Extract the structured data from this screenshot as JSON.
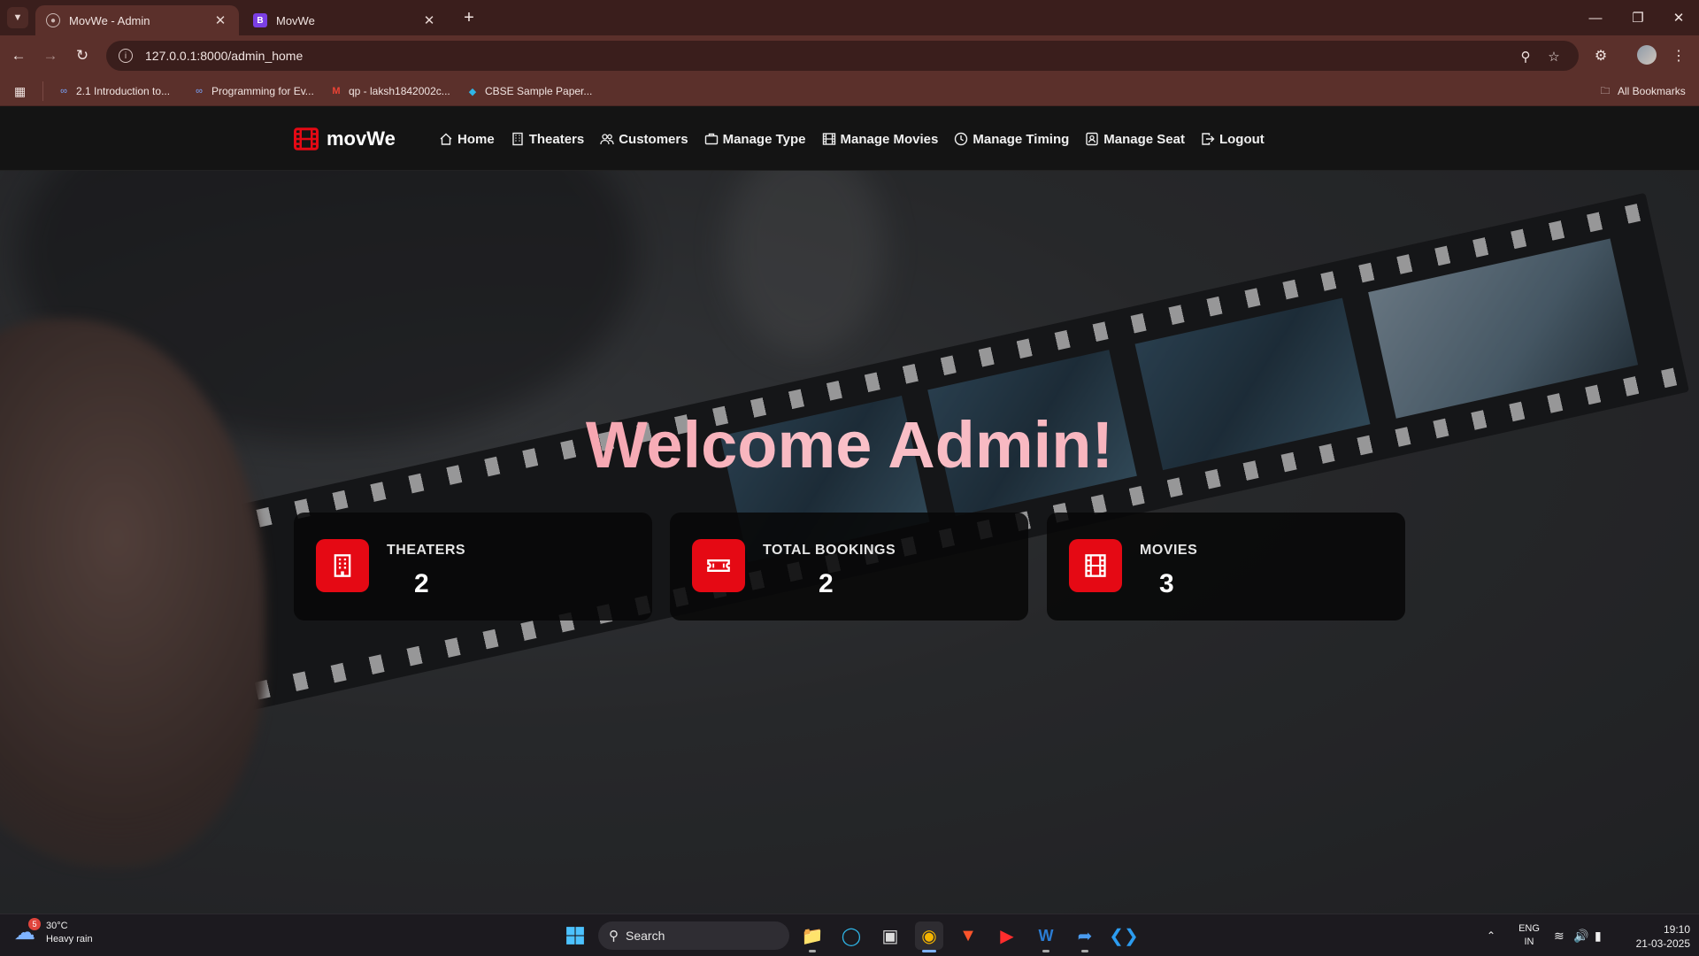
{
  "browser": {
    "tabs": [
      {
        "title": "MovWe - Admin",
        "active": true
      },
      {
        "title": "MovWe",
        "active": false
      }
    ],
    "url": "127.0.0.1:8000/admin_home",
    "bookmarks": [
      "2.1 Introduction to...",
      "Programming for Ev...",
      "qp - laksh1842002c...",
      "CBSE Sample Paper..."
    ],
    "all_bookmarks": "All Bookmarks"
  },
  "site": {
    "brand": "movWe",
    "nav": [
      "Home",
      "Theaters",
      "Customers",
      "Manage Type",
      "Manage Movies",
      "Manage Timing",
      "Manage Seat",
      "Logout"
    ],
    "welcome": "Welcome Admin!",
    "accent_color": "#e50914",
    "stats": [
      {
        "label": "THEATERS",
        "value": "2",
        "icon": "building-icon"
      },
      {
        "label": "TOTAL BOOKINGS",
        "value": "2",
        "icon": "ticket-icon"
      },
      {
        "label": "MOVIES",
        "value": "3",
        "icon": "film-icon"
      }
    ]
  },
  "taskbar": {
    "weather": {
      "temp": "30°C",
      "desc": "Heavy rain",
      "badge": "5"
    },
    "search": "Search",
    "lang": [
      "ENG",
      "IN"
    ],
    "time": "19:10",
    "date": "21-03-2025"
  }
}
